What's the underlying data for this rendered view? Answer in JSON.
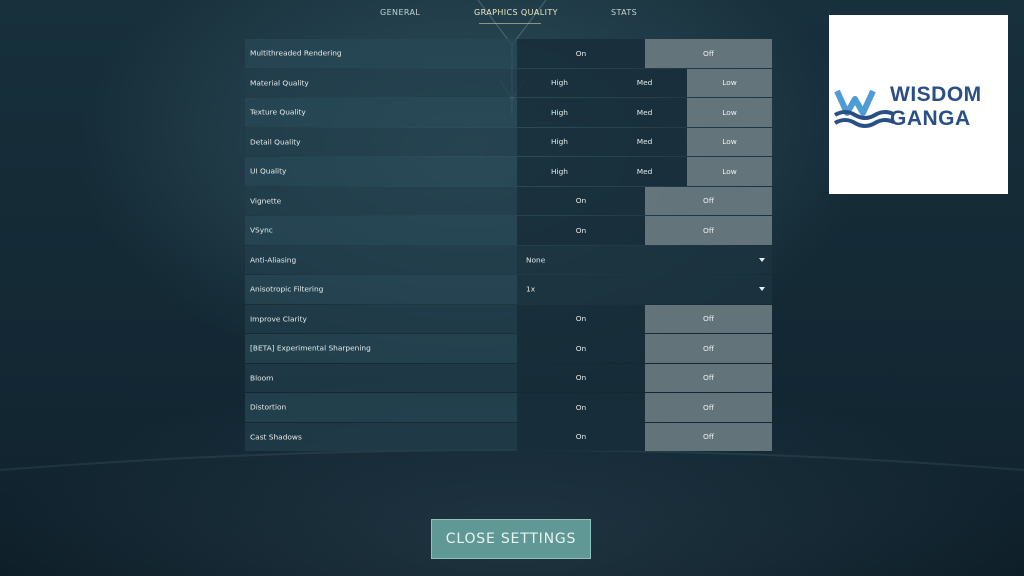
{
  "tabs": [
    {
      "label": "GENERAL",
      "active": false
    },
    {
      "label": "GRAPHICS QUALITY",
      "active": true
    },
    {
      "label": "STATS",
      "active": false
    }
  ],
  "settings": [
    {
      "label": "Multithreaded Rendering",
      "options": [
        "On",
        "Off"
      ],
      "selected": "Off"
    },
    {
      "label": "Material Quality",
      "options": [
        "High",
        "Med",
        "Low"
      ],
      "selected": "Low"
    },
    {
      "label": "Texture Quality",
      "options": [
        "High",
        "Med",
        "Low"
      ],
      "selected": "Low"
    },
    {
      "label": "Detail Quality",
      "options": [
        "High",
        "Med",
        "Low"
      ],
      "selected": "Low"
    },
    {
      "label": "UI Quality",
      "options": [
        "High",
        "Med",
        "Low"
      ],
      "selected": "Low"
    },
    {
      "label": "Vignette",
      "options": [
        "On",
        "Off"
      ],
      "selected": "Off"
    },
    {
      "label": "VSync",
      "options": [
        "On",
        "Off"
      ],
      "selected": "Off"
    },
    {
      "label": "Anti-Aliasing",
      "dropdown": "None"
    },
    {
      "label": "Anisotropic Filtering",
      "dropdown": "1x"
    },
    {
      "label": "Improve Clarity",
      "options": [
        "On",
        "Off"
      ],
      "selected": "Off"
    },
    {
      "label": "[BETA] Experimental Sharpening",
      "options": [
        "On",
        "Off"
      ],
      "selected": "Off"
    },
    {
      "label": "Bloom",
      "options": [
        "On",
        "Off"
      ],
      "selected": "Off"
    },
    {
      "label": "Distortion",
      "options": [
        "On",
        "Off"
      ],
      "selected": "Off"
    },
    {
      "label": "Cast Shadows",
      "options": [
        "On",
        "Off"
      ],
      "selected": "Off"
    }
  ],
  "close_button": {
    "label": "CLOSE SETTINGS"
  },
  "logo": {
    "line1": "WISDOM",
    "line2": "GANGA",
    "icon": "wave-w-logo-icon"
  },
  "colors": {
    "accent_tab": "#ecebc0",
    "selected_option": "#6a7a80",
    "close_button": "#5f9894",
    "logo_blue": "#2a4f86",
    "logo_light_blue": "#4e9cd6"
  }
}
